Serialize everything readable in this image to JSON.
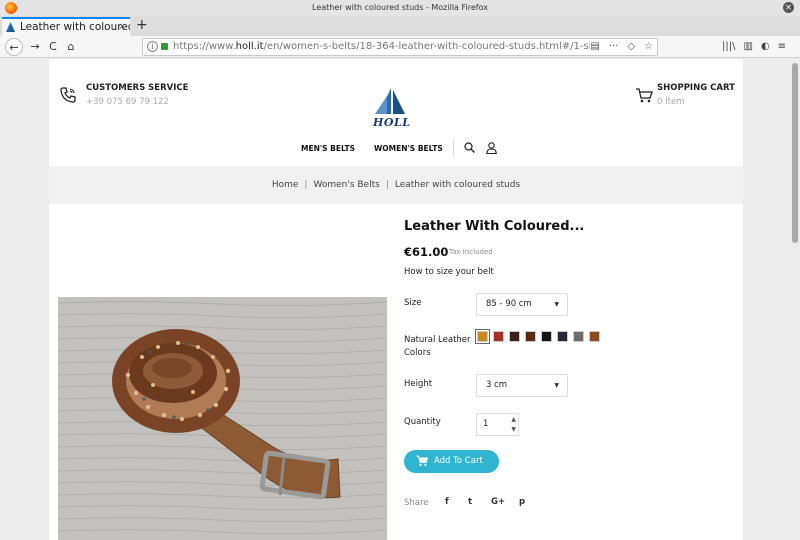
{
  "window": {
    "title": "Leather with coloured studs - Mozilla Firefox"
  },
  "tab": {
    "label": "Leather with coloured",
    "close": "×",
    "new_tab": "+"
  },
  "nav": {
    "back": "←",
    "forward": "→",
    "reload": "C",
    "home": "⌂",
    "url_prefix": "https://www.",
    "url_domain": "holl.it",
    "url_path": "/en/women-s-belts/18-364-leather-with-coloured-studs.html#/1-size",
    "reader": "▤",
    "more": "···",
    "pocket": "◇",
    "star": "☆",
    "library": "|||\\",
    "sidebar": "▥",
    "account": "◐",
    "menu": "≡"
  },
  "header": {
    "customer_service": {
      "title": "CUSTOMERS SERVICE",
      "phone": "+39 075 69 79 122"
    },
    "logo_text": "HOLL",
    "cart": {
      "title": "SHOPPING CART",
      "count": "0 Item"
    },
    "menu": {
      "mens": "MEN'S BELTS",
      "womens": "WOMEN'S BELTS"
    }
  },
  "breadcrumb": {
    "home": "Home",
    "category": "Women's Belts",
    "current": "Leather with coloured studs",
    "sep": "|"
  },
  "product": {
    "title": "Leather With Coloured...",
    "price": "€61.00",
    "tax": "Tax Included",
    "size_guide": "How to size your belt",
    "size_label": "Size",
    "size_value": "85 - 90 cm",
    "colors_label": "Natural Leather Colors",
    "colors": [
      "#c98a26",
      "#a5302a",
      "#3b2218",
      "#5a2a14",
      "#151515",
      "#232a3a",
      "#6e6c6a",
      "#8a4a22"
    ],
    "height_label": "Height",
    "height_value": "3 cm",
    "quantity_label": "Quantity",
    "quantity_value": "1",
    "add_to_cart": "Add To Cart",
    "share_label": "Share",
    "social": {
      "facebook": "f",
      "twitter": "t",
      "googleplus": "G+",
      "pinterest": "p"
    }
  }
}
